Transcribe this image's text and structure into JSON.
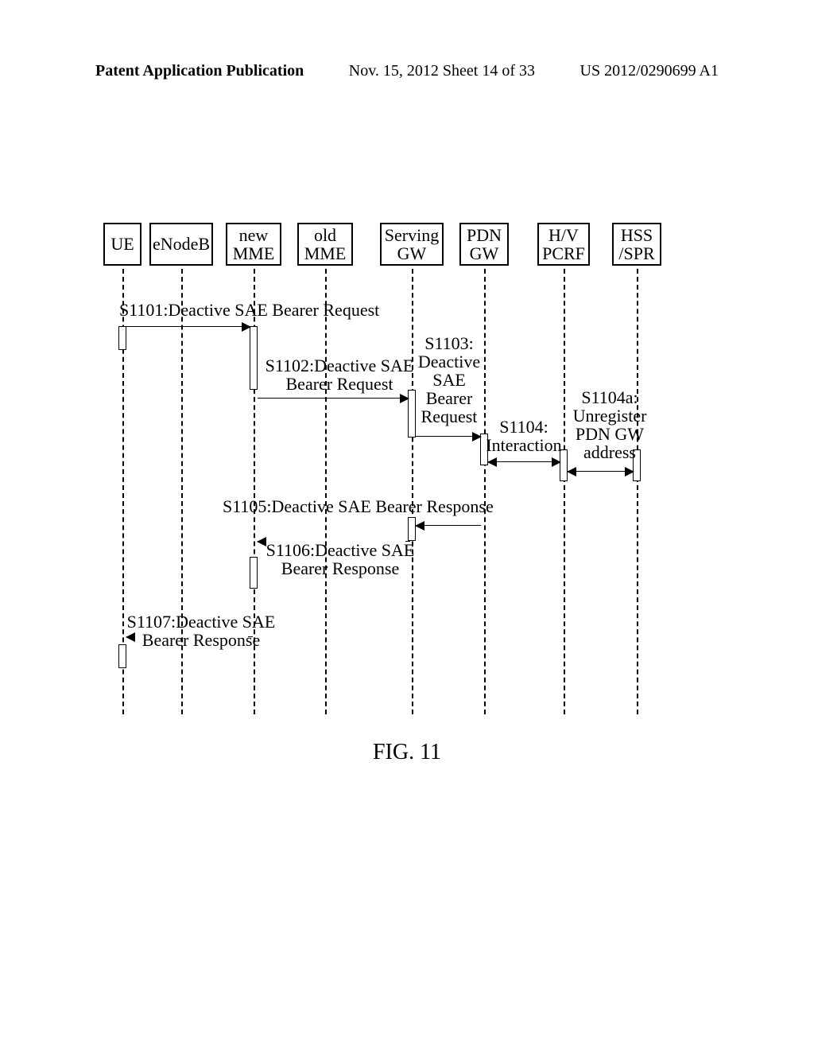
{
  "header": {
    "left": "Patent Application Publication",
    "center": "Nov. 15, 2012  Sheet 14 of 33",
    "right": "US 2012/0290699 A1"
  },
  "diagram": {
    "lifelines": {
      "ue": "UE",
      "enodeb": "eNodeB",
      "new_mme": "new\nMME",
      "old_mme": "old\nMME",
      "serving_gw": "Serving\nGW",
      "pdn_gw": "PDN\nGW",
      "pcrf": "H/V\nPCRF",
      "hss": "HSS\n/SPR"
    },
    "messages": {
      "s1101": "S1101:Deactive SAE Bearer Request",
      "s1102": "S1102:Deactive SAE\nBearer Request",
      "s1103": "S1103:\nDeactive\nSAE\nBearer\nRequest",
      "s1104": "S1104:\nInteraction",
      "s1104a": "S1104a:\nUnregister\nPDN GW\naddress",
      "s1105": "S1105:Deactive SAE Bearer Response",
      "s1106": "S1106:Deactive SAE\nBearer Response",
      "s1107": "S1107:Deactive SAE\nBearer Response"
    }
  },
  "figure_caption": "FIG. 11"
}
